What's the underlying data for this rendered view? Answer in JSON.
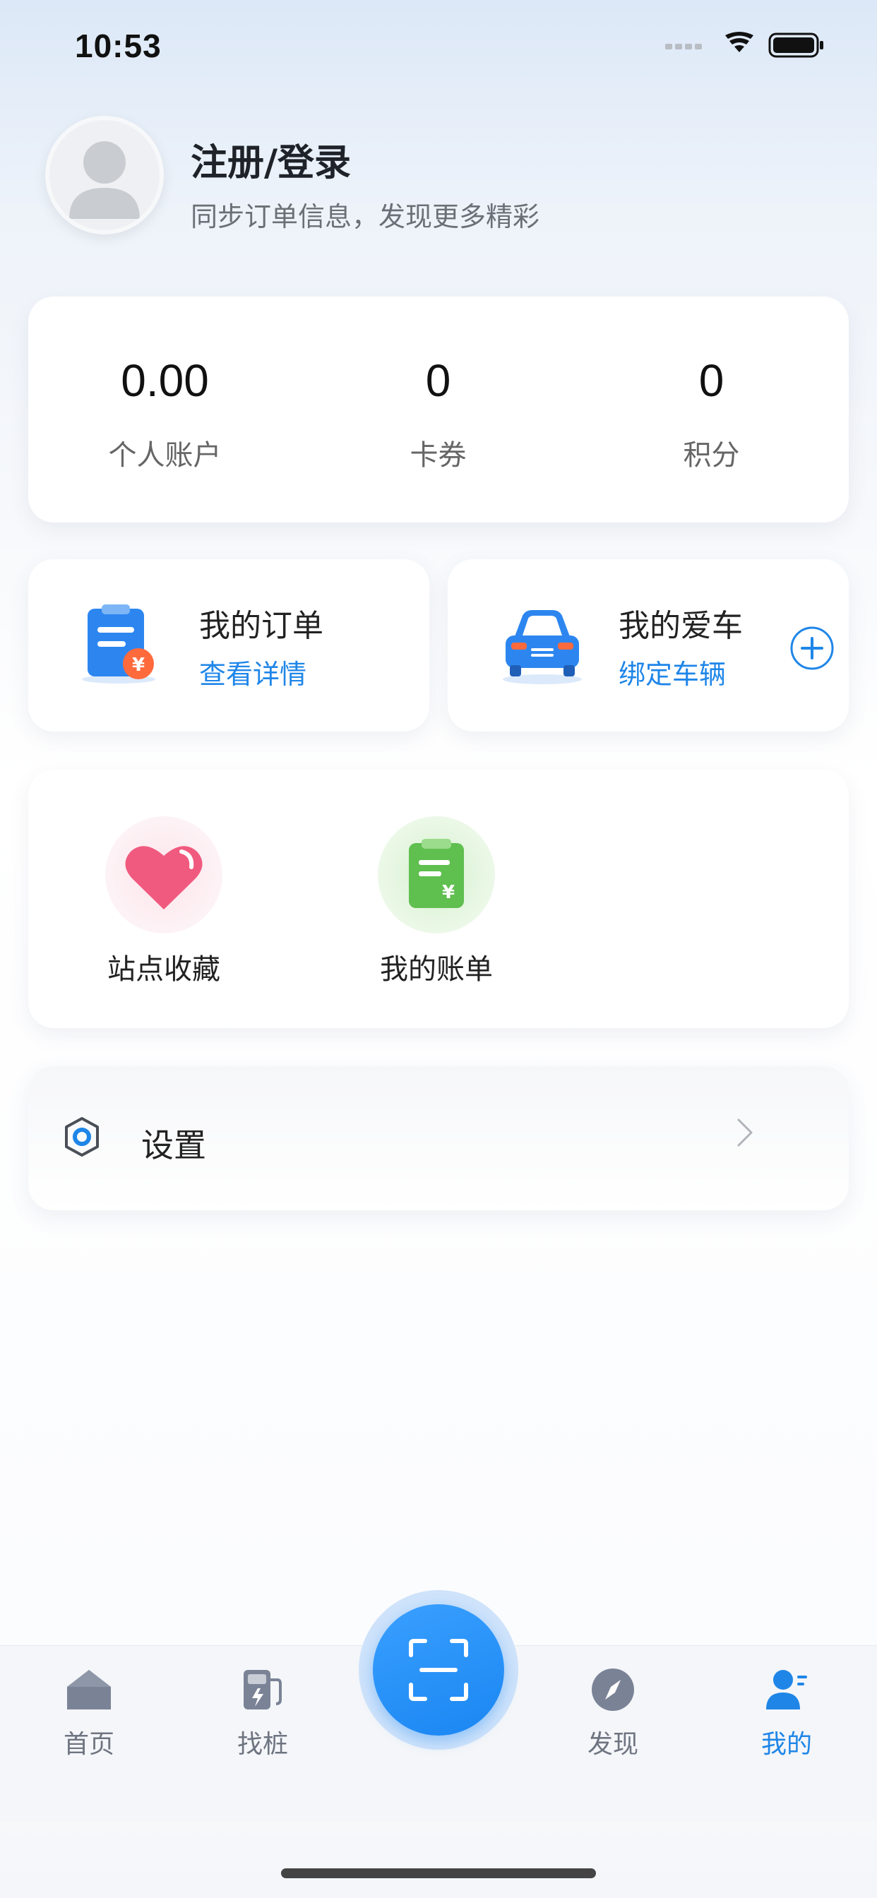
{
  "status_bar": {
    "time": "10:53"
  },
  "profile": {
    "title": "注册/登录",
    "subtitle": "同步订单信息，发现更多精彩"
  },
  "stats": [
    {
      "value": "0.00",
      "label": "个人账户"
    },
    {
      "value": "0",
      "label": "卡券"
    },
    {
      "value": "0",
      "label": "积分"
    }
  ],
  "order_card": {
    "title": "我的订单",
    "link": "查看详情"
  },
  "car_card": {
    "title": "我的爱车",
    "link": "绑定车辆"
  },
  "services": [
    {
      "label": "站点收藏",
      "icon": "heart-icon"
    },
    {
      "label": "我的账单",
      "icon": "bill-icon"
    }
  ],
  "settings": {
    "label": "设置"
  },
  "tabbar": {
    "items": [
      {
        "label": "首页",
        "icon": "home-icon"
      },
      {
        "label": "找桩",
        "icon": "charging-pile-icon"
      },
      {
        "label": "发现",
        "icon": "compass-icon"
      },
      {
        "label": "我的",
        "icon": "user-icon",
        "active": true
      }
    ],
    "scan_icon": "scan-icon"
  },
  "colors": {
    "accent": "#1f86e8",
    "heart": "#f05a7e",
    "bill": "#5fbf4f"
  }
}
